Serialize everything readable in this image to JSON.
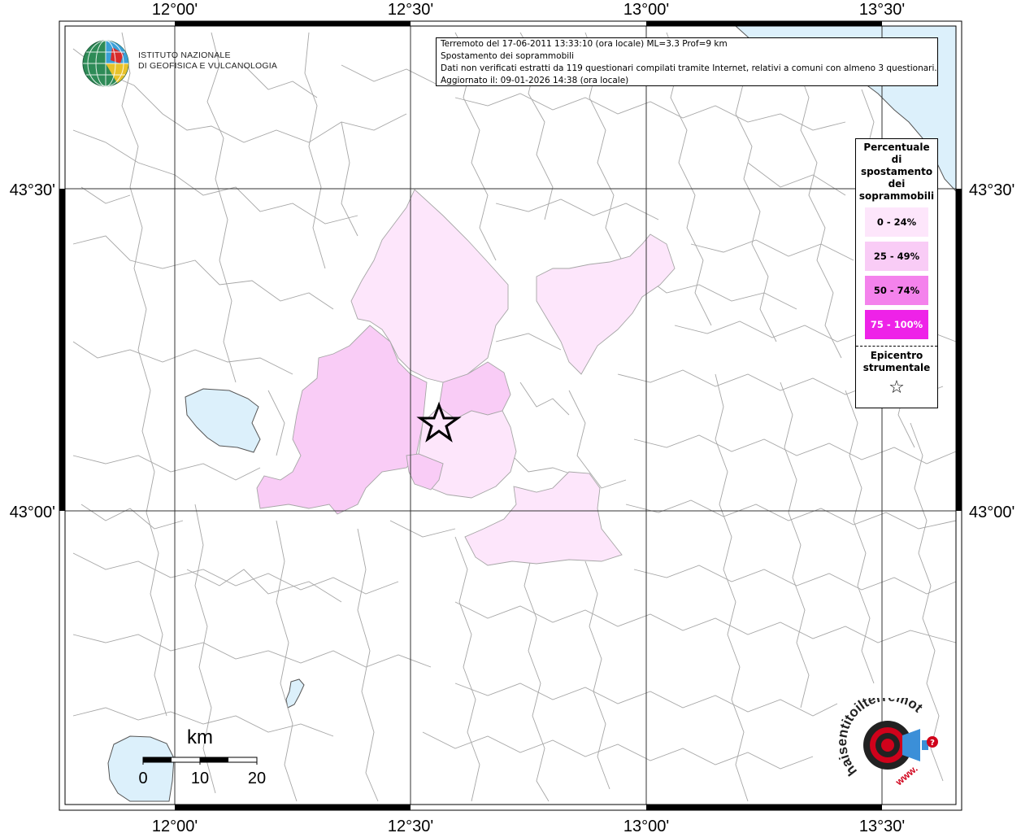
{
  "info": {
    "line1": "Terremoto del 17-06-2011 13:33:10 (ora locale) ML=3.3 Prof=9 km",
    "line2": "Spostamento dei soprammobili",
    "line3": "Dati non verificati estratti da 119 questionari compilati tramite Internet, relativi a comuni con almeno 3 questionari.",
    "line4": "Aggiornato il: 09-01-2026 14:38 (ora locale)"
  },
  "logo": {
    "line1": "ISTITUTO NAZIONALE",
    "line2": "DI GEOFISICA E VULCANOLOGIA"
  },
  "axes": {
    "top": [
      "12°00'",
      "12°30'",
      "13°00'",
      "13°30'"
    ],
    "bottom": [
      "12°00'",
      "12°30'",
      "13°00'",
      "13°30'"
    ],
    "left": [
      "43°30'",
      "43°00'"
    ],
    "right": [
      "43°30'",
      "43°00'"
    ]
  },
  "legend": {
    "title": [
      "Percentuale",
      "di",
      "spostamento",
      "dei",
      "soprammobili"
    ],
    "classes": [
      {
        "label": "0 - 24%",
        "color": "#fde6fb"
      },
      {
        "label": "25 - 49%",
        "color": "#f9ccf6"
      },
      {
        "label": "50 - 74%",
        "color": "#f482ec"
      },
      {
        "label": "75 - 100%",
        "color": "#ee22e8"
      }
    ],
    "epicenter_title": [
      "Epicentro",
      "strumentale"
    ],
    "epicenter_symbol": "☆"
  },
  "scale": {
    "unit": "km",
    "ticks": [
      "0",
      "10",
      "20"
    ]
  },
  "hsi_logo": {
    "text": "haisentitoilterremoto.it",
    "www": "www."
  },
  "colors": {
    "sea": "#dcf0fb",
    "lake": "#dcf0fb",
    "border": "#a6a6a6",
    "grid": "#333333",
    "class0": "#fde6fb",
    "class1": "#f9ccf6",
    "class2": "#f482ec",
    "class3": "#ee22e8"
  }
}
